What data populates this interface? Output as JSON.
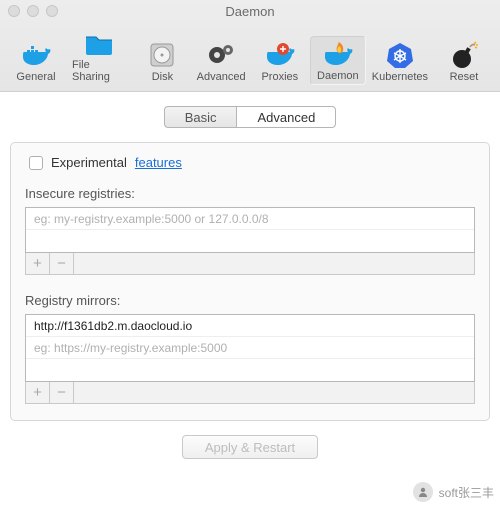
{
  "window": {
    "title": "Daemon"
  },
  "toolbar": {
    "items": [
      {
        "label": "General"
      },
      {
        "label": "File Sharing"
      },
      {
        "label": "Disk"
      },
      {
        "label": "Advanced"
      },
      {
        "label": "Proxies"
      },
      {
        "label": "Daemon"
      },
      {
        "label": "Kubernetes"
      }
    ],
    "reset_label": "Reset"
  },
  "tabs": {
    "basic": "Basic",
    "advanced": "Advanced"
  },
  "experimental": {
    "label": "Experimental",
    "link": "features"
  },
  "registries": {
    "label": "Insecure registries:",
    "placeholder": "eg: my-registry.example:5000 or 127.0.0.0/8"
  },
  "mirrors": {
    "label": "Registry mirrors:",
    "value": "http://f1361db2.m.daocloud.io",
    "placeholder": "eg: https://my-registry.example:5000"
  },
  "footer": {
    "apply": "Apply & Restart"
  },
  "watermark": {
    "text": "soft张三丰"
  }
}
